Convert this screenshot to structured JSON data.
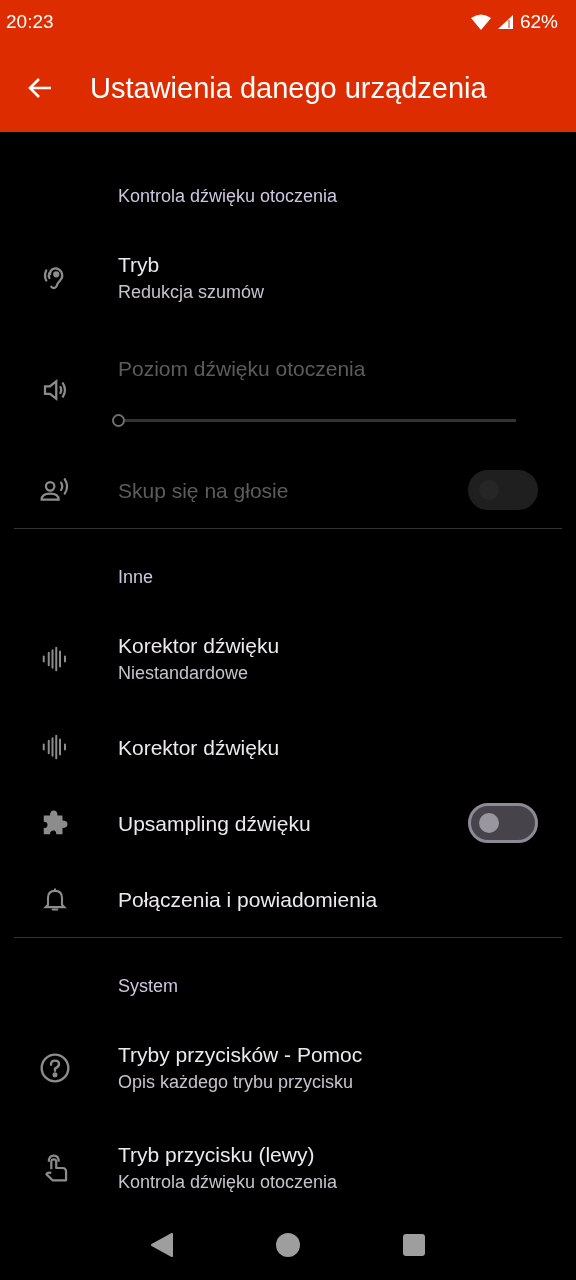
{
  "status_bar": {
    "time": "20:23",
    "battery": "62%"
  },
  "app_bar": {
    "title": "Ustawienia danego urządzenia"
  },
  "sections": [
    {
      "header": "Kontrola dźwięku otoczenia",
      "items": [
        {
          "kind": "text",
          "title": "Tryb",
          "subtitle": "Redukcja szumów",
          "disabled": false
        },
        {
          "kind": "slider",
          "title": "Poziom dźwięku otoczenia",
          "level": 0,
          "disabled": true
        },
        {
          "kind": "switch",
          "title": "Skup się na głosie",
          "on": false,
          "disabled": true
        }
      ]
    },
    {
      "header": "Inne",
      "items": [
        {
          "kind": "text",
          "title": "Korektor dźwięku",
          "subtitle": "Niestandardowe",
          "disabled": false
        },
        {
          "kind": "text",
          "title": "Korektor dźwięku",
          "disabled": false
        },
        {
          "kind": "switch",
          "title": "Upsampling dźwięku",
          "on": false,
          "disabled": false
        },
        {
          "kind": "text",
          "title": "Połączenia i powiadomienia",
          "disabled": false
        }
      ]
    },
    {
      "header": "System",
      "items": [
        {
          "kind": "text",
          "title": "Tryby przycisków - Pomoc",
          "subtitle": "Opis każdego trybu przycisku",
          "disabled": false
        },
        {
          "kind": "text",
          "title": "Tryb przycisku (lewy)",
          "subtitle": "Kontrola dźwięku otoczenia",
          "disabled": false
        }
      ]
    }
  ]
}
